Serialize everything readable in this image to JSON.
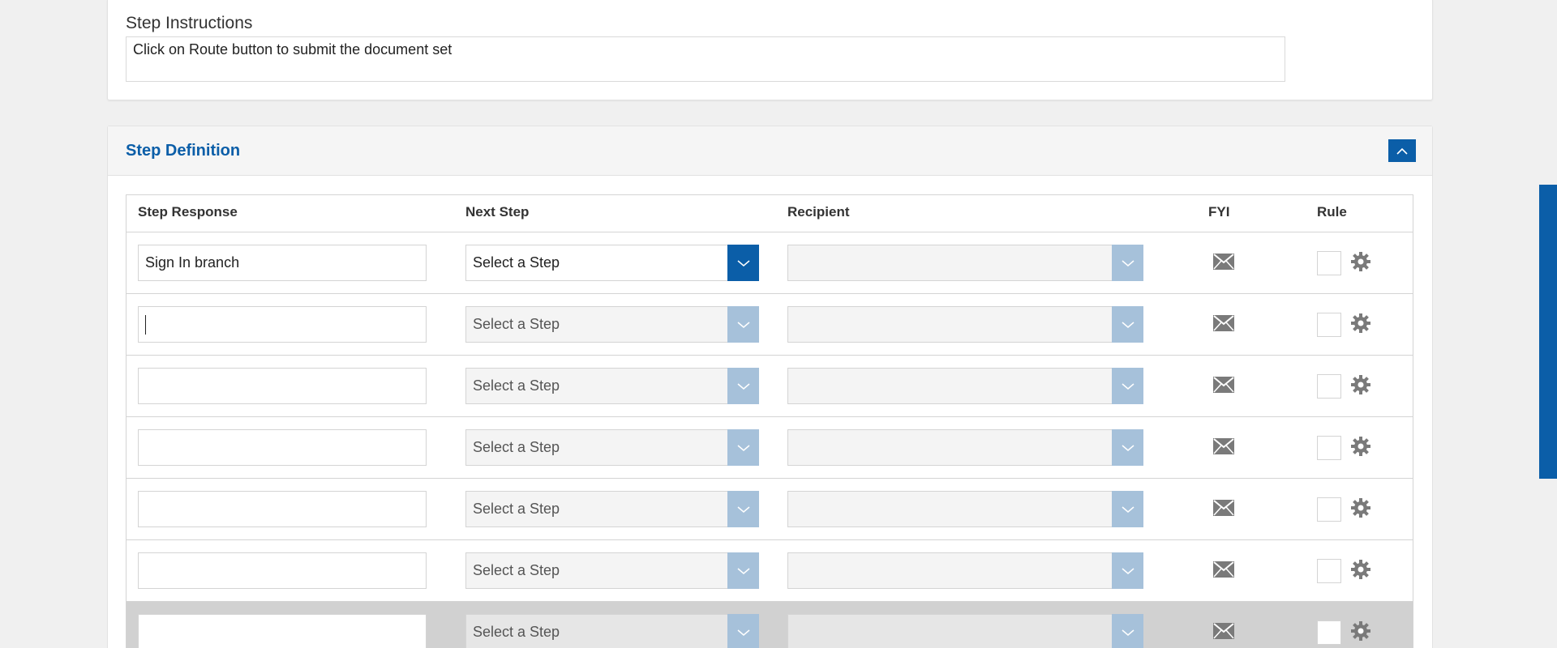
{
  "instructions": {
    "label": "Step Instructions",
    "text": "Click on Route button to submit the document set"
  },
  "step_definition": {
    "title": "Step Definition",
    "collapse_icon": "chevron-up-icon",
    "columns": {
      "step_response": "Step Response",
      "next_step": "Next Step",
      "recipient": "Recipient",
      "fyi": "FYI",
      "rule": "Rule"
    },
    "select_placeholder": "Select a Step",
    "rows": [
      {
        "response": "Sign In branch",
        "next_step": "Select a Step",
        "recipient": ""
      },
      {
        "response": "",
        "next_step": "Select a Step",
        "recipient": ""
      },
      {
        "response": "",
        "next_step": "Select a Step",
        "recipient": ""
      },
      {
        "response": "",
        "next_step": "Select a Step",
        "recipient": ""
      },
      {
        "response": "",
        "next_step": "Select a Step",
        "recipient": ""
      },
      {
        "response": "",
        "next_step": "Select a Step",
        "recipient": ""
      },
      {
        "response": "",
        "next_step": "Select a Step",
        "recipient": ""
      }
    ]
  },
  "colors": {
    "accent": "#0b5ea8",
    "dropdown_disabled": "#a6c1da",
    "icon_gray": "#7a7a7a"
  }
}
